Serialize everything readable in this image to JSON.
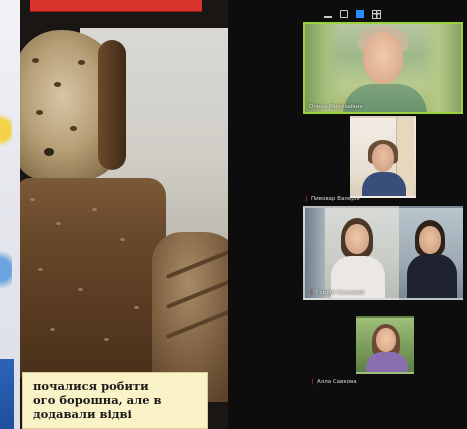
{
  "slide": {
    "caption_lines": [
      "почалися робити",
      "ого борошна, але в",
      "додавали відві"
    ]
  },
  "toolbar": {
    "icons": [
      "minimize-icon",
      "speaker-view-icon",
      "gallery-view-icon",
      "grid-icon"
    ]
  },
  "participants": [
    {
      "name": "Олена Миколаївна",
      "muted": false,
      "active": true
    },
    {
      "name": "Пивовар Валерія",
      "muted": true,
      "active": false
    },
    {
      "name": "Гордій Сасковий",
      "muted": true,
      "active": false
    },
    {
      "name": "",
      "muted": false,
      "active": false
    },
    {
      "name": "Алла Савкова",
      "muted": true,
      "active": false
    }
  ],
  "colors": {
    "active_border": "#9bd13a",
    "mic_muted": "#e0403a",
    "slide_banner": "#d8332a",
    "caption_bg": "#fbf3c8"
  }
}
